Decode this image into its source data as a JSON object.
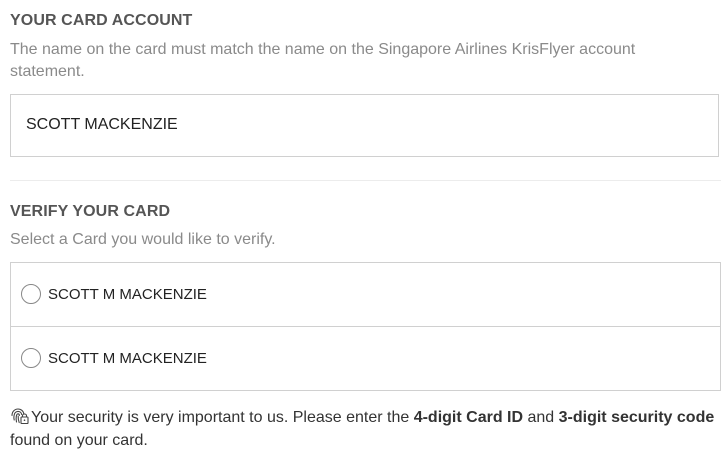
{
  "card_account": {
    "heading": "YOUR CARD ACCOUNT",
    "description": "The name on the card must match the name on the Singapore Airlines KrisFlyer account statement.",
    "name_value": "SCOTT MACKENZIE"
  },
  "verify_card": {
    "heading": "VERIFY YOUR CARD",
    "description": "Select a Card you would like to verify.",
    "cards": [
      {
        "label": "SCOTT M MACKENZIE",
        "selected": false
      },
      {
        "label": "SCOTT M MACKENZIE",
        "selected": false
      }
    ]
  },
  "security_note": {
    "icon": "fingerprint-lock-icon",
    "text_1": "Your security is very important to us. Please enter the ",
    "bold_1": "4-digit Card ID",
    "text_2": " and ",
    "bold_2": "3-digit security code",
    "text_3": " found on your card."
  }
}
